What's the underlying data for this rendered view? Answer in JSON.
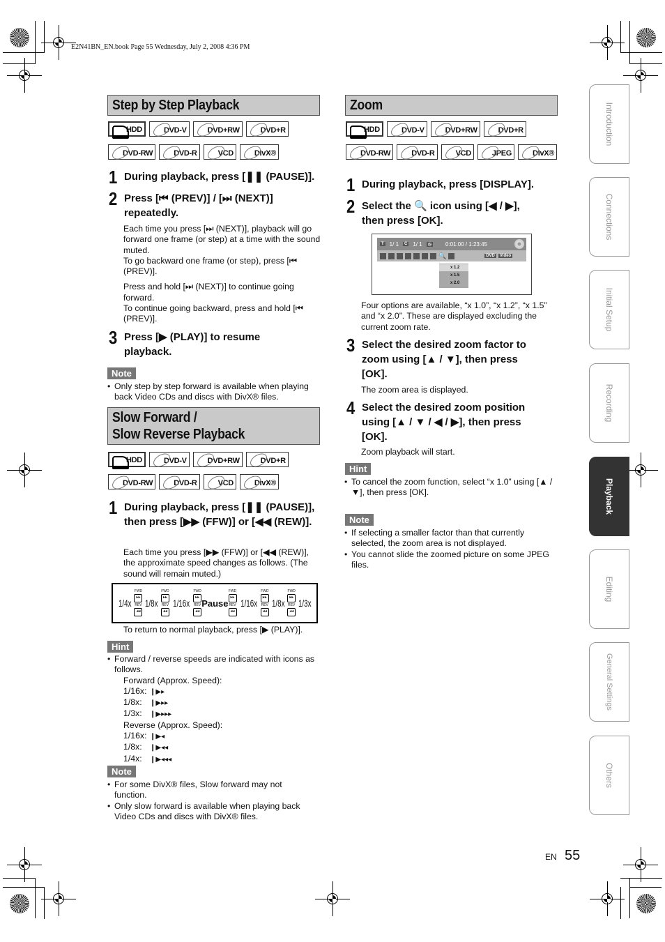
{
  "header": {
    "book_line": "E2N41BN_EN.book  Page 55  Wednesday, July 2, 2008  4:36 PM"
  },
  "left": {
    "step_by_step": {
      "title": "Step by Step Playback",
      "badges_row1": [
        "HDD",
        "DVD-V",
        "DVD+RW",
        "DVD+R"
      ],
      "badges_row2": [
        "DVD-RW",
        "DVD-R",
        "VCD",
        "DivX®"
      ],
      "step1": {
        "num": "1",
        "text": "During playback, press [❚❚ (PAUSE)]."
      },
      "step2": {
        "num": "2",
        "text": "Press [⏮ (PREV)] / [⏭ (NEXT)] repeatedly."
      },
      "step2_para1": "Each time you press [⏭ (NEXT)], playback will go forward one frame (or step) at a time with the sound muted.",
      "step2_para2": "To go backward one frame (or step), press [⏮ (PREV)].",
      "step2_para3": "Press and hold [⏭ (NEXT)] to continue going forward.",
      "step2_para4": "To continue going backward, press and hold [⏮ (PREV)].",
      "step3": {
        "num": "3",
        "text": "Press [▶ (PLAY)] to resume playback."
      },
      "note_label": "Note",
      "note_items": [
        "Only step by step forward is available when playing back Video CDs and discs with DivX® files."
      ]
    },
    "slow": {
      "title_line1": "Slow Forward /",
      "title_line2": "Slow Reverse Playback",
      "badges_row1": [
        "HDD",
        "DVD-V",
        "DVD+RW",
        "DVD+R"
      ],
      "badges_row2": [
        "DVD-RW",
        "DVD-R",
        "VCD",
        "DivX®"
      ],
      "step1": {
        "num": "1",
        "text": "During playback, press [❚❚ (PAUSE)], then press [▶▶ (FFW)] or [◀◀ (REW)]."
      },
      "step1_para": "Each time you press [▶▶ (FFW)] or [◀◀ (REW)], the approximate speed changes as follows. (The sound will remain muted.)",
      "speeds": [
        "1/4x",
        "1/8x",
        "1/16x",
        "Pause",
        "1/16x",
        "1/8x",
        "1/3x"
      ],
      "fwd_label": "FWD",
      "rev_label": "REV",
      "return_text": "To return to normal playback, press [▶ (PLAY)].",
      "hint_label": "Hint",
      "hint_intro": "Forward / reverse speeds are indicated with icons as follows.",
      "forward_heading": "Forward (Approx. Speed):",
      "forward": [
        {
          "speed": "1/16x:",
          "icon": "❙▶▸"
        },
        {
          "speed": "1/8x:",
          "icon": "❙▶▸▸"
        },
        {
          "speed": "1/3x:",
          "icon": "❙▶▸▸▸"
        }
      ],
      "reverse_heading": "Reverse (Approx. Speed):",
      "reverse": [
        {
          "speed": "1/16x:",
          "icon": "❙▶◂"
        },
        {
          "speed": "1/8x:",
          "icon": "❙▶◂◂"
        },
        {
          "speed": "1/4x:",
          "icon": "❙▶◂◂◂"
        }
      ],
      "note_label": "Note",
      "note_items": [
        "For some DivX® files, Slow forward may not function.",
        "Only slow forward is available when playing back Video CDs and discs with DivX® files."
      ]
    }
  },
  "right": {
    "title": "Zoom",
    "badges_row1": [
      "HDD",
      "DVD-V",
      "DVD+RW",
      "DVD+R"
    ],
    "badges_row2": [
      "DVD-RW",
      "DVD-R",
      "VCD",
      "JPEG",
      "DivX®"
    ],
    "step1": {
      "num": "1",
      "text": "During playback, press [DISPLAY]."
    },
    "step2": {
      "num": "2",
      "text": "Select the 🔍 icon using [◀ / ▶], then press [OK]."
    },
    "osd": {
      "title_mark": "T",
      "title_val": "1/   1",
      "chapter_mark": "C",
      "chapter_val": "1/   1",
      "time": "0:01:00 / 1:23:45",
      "tag1": "DVD",
      "tag2": "Video",
      "options": [
        "x 1.2",
        "x 1.5",
        "x 2.0"
      ]
    },
    "step2_para": "Four options are available, “x 1.0”, “x 1.2”, “x 1.5” and “x 2.0”. These are displayed excluding the current zoom rate.",
    "step3": {
      "num": "3",
      "text": "Select the desired zoom factor to zoom using [▲ / ▼], then press [OK]."
    },
    "step3_para": "The zoom area is displayed.",
    "step4": {
      "num": "4",
      "text": "Select the desired zoom position using [▲ / ▼ / ◀ / ▶], then press [OK]."
    },
    "step4_para": "Zoom playback will start.",
    "hint_label": "Hint",
    "hint_items": [
      "To cancel the zoom function, select “x 1.0” using [▲ / ▼], then press [OK]."
    ],
    "note_label": "Note",
    "note_items": [
      "If selecting a smaller factor than that currently selected, the zoom area is not displayed.",
      "You cannot slide the zoomed picture on some JPEG files."
    ]
  },
  "tabs": [
    "Introduction",
    "Connections",
    "Initial Setup",
    "Recording",
    "Playback",
    "Editing",
    "General Settings",
    "Others"
  ],
  "active_tab": "Playback",
  "footer": {
    "lang": "EN",
    "page": "55"
  }
}
